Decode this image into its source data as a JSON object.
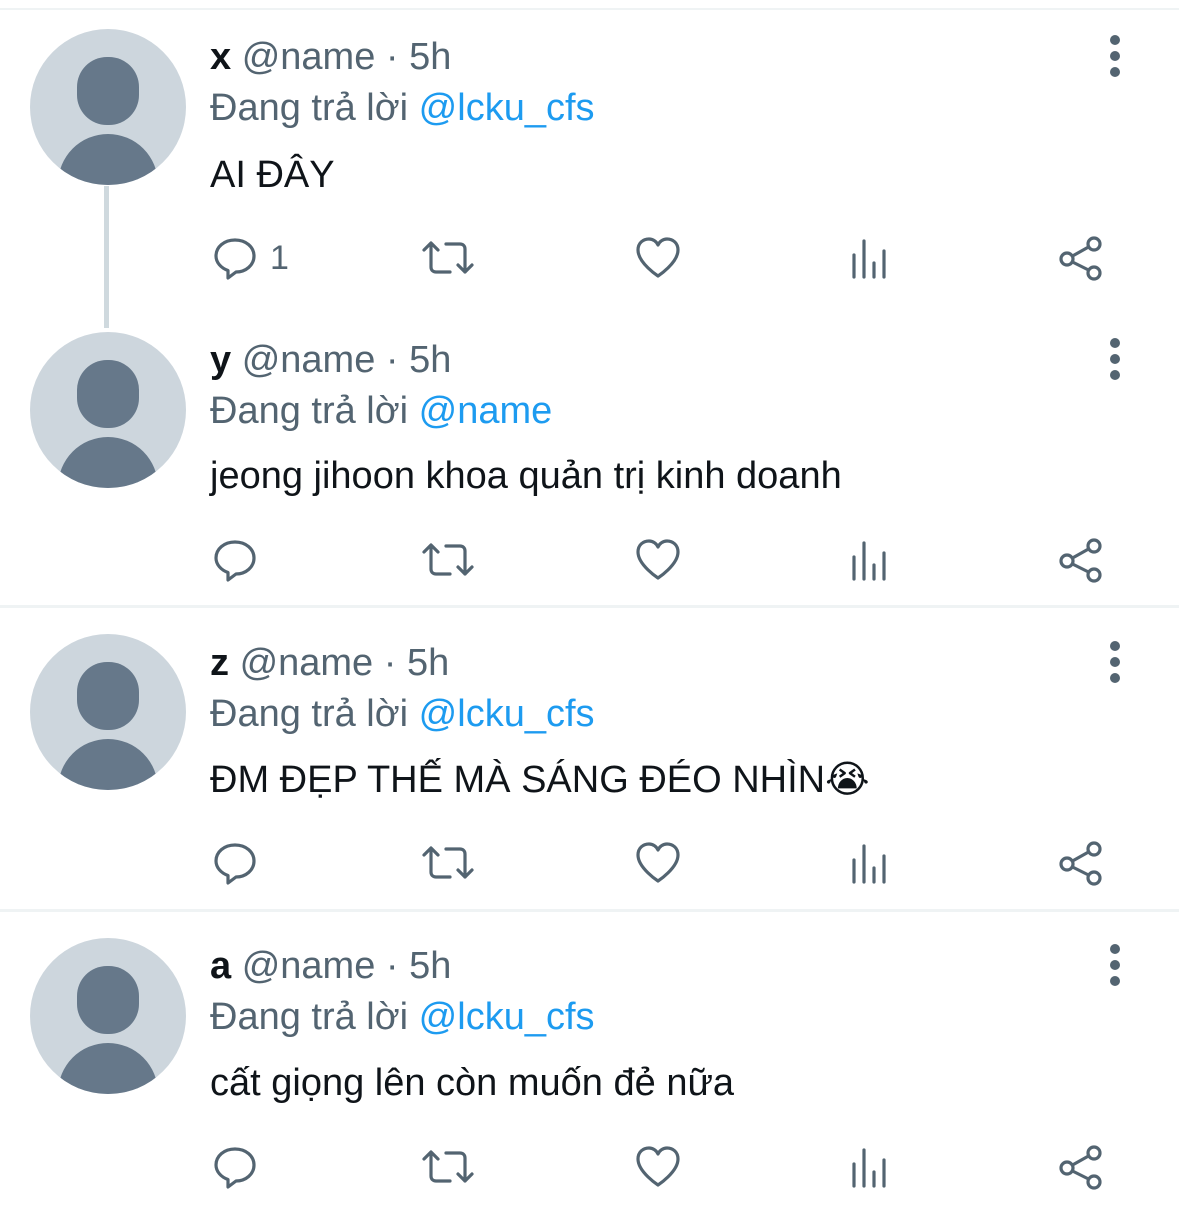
{
  "reply_prefix": "Đang trả lời",
  "tweets": [
    {
      "name": "x",
      "handle": "@name",
      "dot": "·",
      "time": "5h",
      "replying_to": "@lcku_cfs",
      "text": "AI ĐÂY",
      "reply_count": "1"
    },
    {
      "name": "y",
      "handle": "@name",
      "dot": "·",
      "time": "5h",
      "replying_to": "@name",
      "text": "jeong jihoon khoa quản trị kinh doanh",
      "reply_count": ""
    },
    {
      "name": "z",
      "handle": "@name",
      "dot": "·",
      "time": "5h",
      "replying_to": "@lcku_cfs",
      "text": "ĐM ĐẸP THẾ MÀ SÁNG ĐÉO NHÌN😭",
      "reply_count": ""
    },
    {
      "name": "a",
      "handle": "@name",
      "dot": "·",
      "time": "5h",
      "replying_to": "@lcku_cfs",
      "text": "cất giọng lên còn muốn đẻ nữa",
      "reply_count": ""
    }
  ],
  "icons": [
    "more-icon",
    "reply-icon",
    "retweet-icon",
    "like-icon",
    "views-icon",
    "share-icon"
  ],
  "colors": {
    "text": "#0f1419",
    "secondary": "#536471",
    "mention": "#1d9bf0",
    "avatar_bg": "#cdd6dd",
    "avatar_fg": "#66788a",
    "divider": "#eff3f4",
    "thread_line": "#cfd9de"
  }
}
